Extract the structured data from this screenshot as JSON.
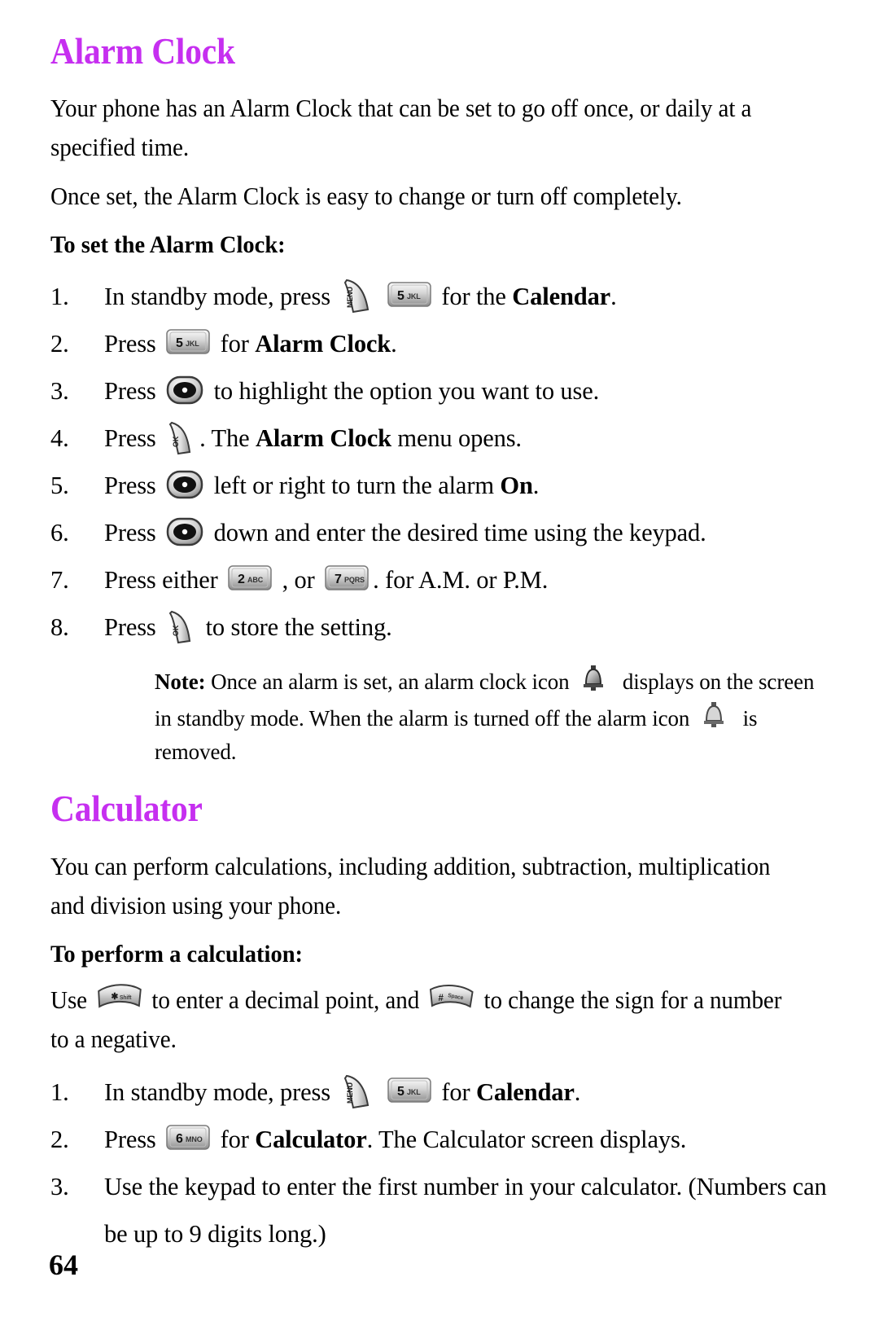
{
  "page": {
    "number": "64",
    "heading_color": "#c62ff0"
  },
  "alarm_section": {
    "heading": "Alarm Clock",
    "intro_1": "Your phone has an Alarm Clock that can be set to go off once, or daily at a specified time.",
    "intro_2": "Once set, the Alarm Clock is easy to change or turn off completely.",
    "sub_heading": "To set the Alarm Clock:",
    "steps": [
      {
        "num": "1.",
        "parts": [
          {
            "type": "text",
            "value": "In standby mode, press "
          },
          {
            "type": "key",
            "icon": "menu-key",
            "label": "MENU"
          },
          {
            "type": "text",
            "value": " "
          },
          {
            "type": "key",
            "icon": "key-5",
            "label": "5 JKL"
          },
          {
            "type": "text",
            "value": " for the "
          },
          {
            "type": "bold",
            "value": "Calendar"
          },
          {
            "type": "text",
            "value": "."
          }
        ]
      },
      {
        "num": "2.",
        "parts": [
          {
            "type": "text",
            "value": "Press "
          },
          {
            "type": "key",
            "icon": "key-5",
            "label": "5 JKL"
          },
          {
            "type": "text",
            "value": " for "
          },
          {
            "type": "bold",
            "value": "Alarm Clock"
          },
          {
            "type": "text",
            "value": "."
          }
        ]
      },
      {
        "num": "3.",
        "parts": [
          {
            "type": "text",
            "value": "Press "
          },
          {
            "type": "key",
            "icon": "navigation-key",
            "label": "nav"
          },
          {
            "type": "text",
            "value": " to highlight the option you want to use."
          }
        ]
      },
      {
        "num": "4.",
        "parts": [
          {
            "type": "text",
            "value": "Press "
          },
          {
            "type": "key",
            "icon": "ok-key",
            "label": "OK"
          },
          {
            "type": "text",
            "value": ". The "
          },
          {
            "type": "bold",
            "value": "Alarm Clock"
          },
          {
            "type": "text",
            "value": " menu opens."
          }
        ]
      },
      {
        "num": "5.",
        "parts": [
          {
            "type": "text",
            "value": "Press "
          },
          {
            "type": "key",
            "icon": "navigation-key",
            "label": "nav"
          },
          {
            "type": "text",
            "value": " left or right to turn the alarm "
          },
          {
            "type": "bold",
            "value": "On"
          },
          {
            "type": "text",
            "value": "."
          }
        ]
      },
      {
        "num": "6.",
        "parts": [
          {
            "type": "text",
            "value": "Press "
          },
          {
            "type": "key",
            "icon": "navigation-key",
            "label": "nav"
          },
          {
            "type": "text",
            "value": " down and enter the desired time using the keypad."
          }
        ]
      },
      {
        "num": "7.",
        "parts": [
          {
            "type": "text",
            "value": "Press either "
          },
          {
            "type": "key",
            "icon": "key-2",
            "label": "2 ABC"
          },
          {
            "type": "text",
            "value": " , or "
          },
          {
            "type": "key",
            "icon": "key-7",
            "label": "7 PQRS"
          },
          {
            "type": "text",
            "value": ". for A.M. or P.M."
          }
        ]
      },
      {
        "num": "8.",
        "parts": [
          {
            "type": "text",
            "value": "Press "
          },
          {
            "type": "key",
            "icon": "ok-key",
            "label": "OK"
          },
          {
            "type": "text",
            "value": " to store the setting."
          }
        ]
      }
    ],
    "note": {
      "label": "Note:",
      "text_1": " Once an alarm is set, an alarm clock icon ",
      "icon_1": "alarm-bell-on-icon",
      "text_2": " displays on the screen in standby mode. When the alarm is turned off the alarm icon ",
      "icon_2": "alarm-bell-off-icon",
      "text_3": " is removed."
    }
  },
  "calculator_section": {
    "heading": "Calculator",
    "intro_1": "You can perform calculations, including addition, subtraction, multiplication and division using your phone.",
    "sub_heading": "To perform a calculation:",
    "use_line": {
      "part_1": "Use ",
      "icon_1": "star-key",
      "part_2": " to enter a decimal point, and ",
      "icon_2": "pound-space-key",
      "part_3": " to change the sign for a number to a negative."
    },
    "steps": [
      {
        "num": "1.",
        "parts": [
          {
            "type": "text",
            "value": "In standby mode, press "
          },
          {
            "type": "key",
            "icon": "menu-key",
            "label": "MENU"
          },
          {
            "type": "text",
            "value": " "
          },
          {
            "type": "key",
            "icon": "key-5",
            "label": "5 JKL"
          },
          {
            "type": "text",
            "value": " for "
          },
          {
            "type": "bold",
            "value": "Calendar"
          },
          {
            "type": "text",
            "value": "."
          }
        ]
      },
      {
        "num": "2.",
        "parts": [
          {
            "type": "text",
            "value": "Press "
          },
          {
            "type": "key",
            "icon": "key-6",
            "label": "6 MNO"
          },
          {
            "type": "text",
            "value": " for "
          },
          {
            "type": "bold",
            "value": "Calculator"
          },
          {
            "type": "text",
            "value": ". The Calculator screen displays."
          }
        ]
      },
      {
        "num": "3.",
        "parts": [
          {
            "type": "text",
            "value": "Use the keypad to enter the first number in your calculator. (Numbers can be up to 9 digits long.)"
          }
        ]
      }
    ]
  }
}
